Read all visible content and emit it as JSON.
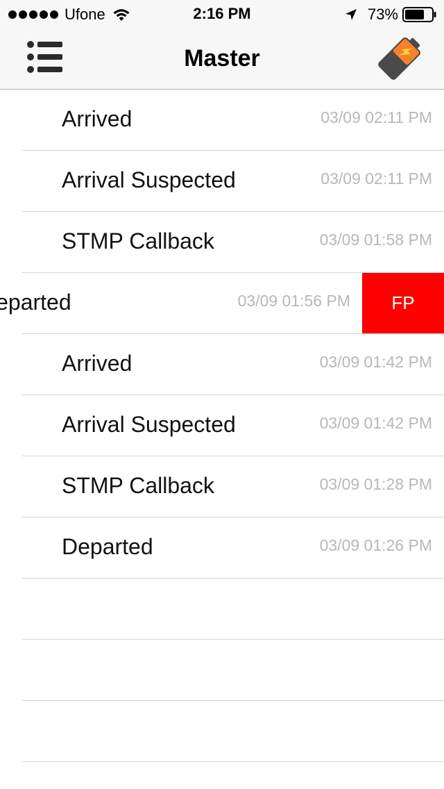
{
  "status_bar": {
    "carrier": "Ufone",
    "time": "2:16 PM",
    "battery_percent": "73%",
    "battery_level": 0.73,
    "icons": [
      "signal-dots",
      "wifi-icon",
      "location-arrow-icon",
      "battery-icon"
    ]
  },
  "nav": {
    "title": "Master",
    "left_icon": "list-menu-icon",
    "right_icon": "battery-charging-icon",
    "right_icon_color": "#f5822a",
    "right_icon_body_color": "#4a4a4a"
  },
  "rows": [
    {
      "title": "Arrived",
      "time": "03/09 02:11 PM"
    },
    {
      "title": "Arrival Suspected",
      "time": "03/09 02:11 PM"
    },
    {
      "title": "STMP Callback",
      "time": "03/09 01:58 PM"
    },
    {
      "title": "Departed",
      "time": "03/09 01:56 PM",
      "action_label": "FP",
      "action_color": "#ff0000"
    },
    {
      "title": "Arrived",
      "time": "03/09 01:42 PM"
    },
    {
      "title": "Arrival Suspected",
      "time": "03/09 01:42 PM"
    },
    {
      "title": "STMP Callback",
      "time": "03/09 01:28 PM"
    },
    {
      "title": "Departed",
      "time": "03/09 01:26 PM"
    }
  ]
}
